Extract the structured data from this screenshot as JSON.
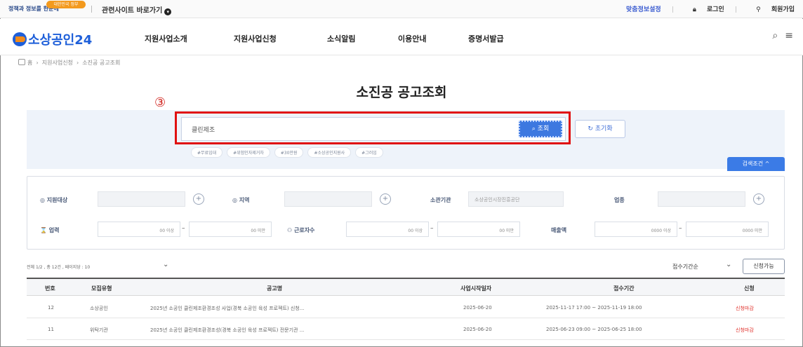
{
  "utility": {
    "gov_logo": "정책과 정보를 한눈에",
    "gov_badge": "대한민국 정부",
    "related_sites": "관련사이트 바로가기",
    "custom_info": "맞춤정보설정",
    "login": "로그인",
    "signup": "회원가입"
  },
  "brand": {
    "name": "소상공인24"
  },
  "nav": {
    "items": [
      "지원사업소개",
      "지원사업신청",
      "소식알림",
      "이용안내",
      "증명서발급"
    ]
  },
  "breadcrumb": {
    "home": "홈",
    "items": [
      "지원사업신청",
      "소진공 공고조회"
    ]
  },
  "page": {
    "title": "소진공 공고조회",
    "step_marker": "③"
  },
  "search": {
    "value": "클린제조",
    "button": "조회",
    "reset": "초기화",
    "tags": [
      "#무료임대",
      "#위험인자제거차",
      "#30만원",
      "#소상공인지원사",
      "#그러임"
    ],
    "toggle": "검색조건 ^"
  },
  "filters": {
    "target_label": "지원대상",
    "region_label": "지역",
    "agency_label": "소관기관",
    "agency_value": "소상공인시장진흥공단",
    "industry_label": "업종",
    "age_label": "업력",
    "age_from": "00 이상",
    "age_to": "00 미만",
    "employees_label": "근로자수",
    "employees_from": "00 이상",
    "employees_to": "00 미만",
    "sales_label": "매출액",
    "sales_from": "0000 이상",
    "sales_to": "0000 미만"
  },
  "list": {
    "count": "전체 1/2 , 총 12건 , 페이지당 : 10",
    "sort": "접수기간순",
    "available_button": "신청가능",
    "headers": [
      "번호",
      "모집유형",
      "공고명",
      "사업시작일자",
      "접수기간",
      "신청"
    ],
    "rows": [
      {
        "no": "12",
        "type": "소상공인",
        "title": "2025년 소공인 클린제조환경조성 사업(경북 소공인 육성 프로젝트) 신청...",
        "start": "2025-06-20",
        "period": "2025-11-17 17:00 ~ 2025-11-19 18:00",
        "status": "신청마감"
      },
      {
        "no": "11",
        "type": "위탁기관",
        "title": "2025년 소공인 클린제조환경조성(경북 소공인 육성 프로젝트) 전문기관 ...",
        "start": "2025-06-20",
        "period": "2025-06-23 09:00 ~ 2025-06-25 18:00",
        "status": "신청마감"
      }
    ]
  }
}
